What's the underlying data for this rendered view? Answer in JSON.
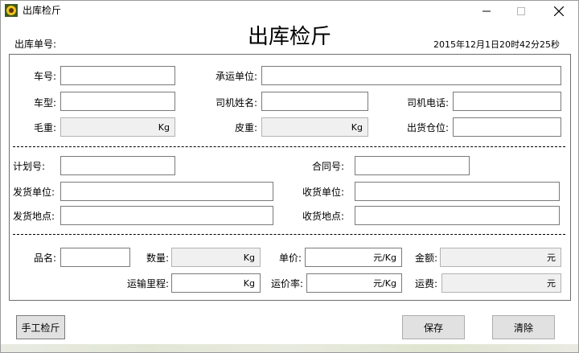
{
  "window": {
    "title": "出库检斤",
    "icon": "sunflower-icon",
    "minimize_icon": "minimize-icon",
    "maximize_icon": "maximize-icon",
    "close_icon": "close-icon"
  },
  "header": {
    "order_no_label": "出库单号:",
    "title": "出库检斤",
    "datetime": "2015年12月1日20时42分25秒"
  },
  "vehicle": {
    "car_no_label": "车号:",
    "car_no_value": "",
    "carrier_label": "承运单位:",
    "carrier_value": "",
    "car_type_label": "车型:",
    "car_type_value": "",
    "driver_name_label": "司机姓名:",
    "driver_name_value": "",
    "driver_phone_label": "司机电话:",
    "driver_phone_value": "",
    "gross_label": "毛重:",
    "gross_value": "",
    "gross_unit": "Kg",
    "tare_label": "皮重:",
    "tare_value": "",
    "tare_unit": "Kg",
    "warehouse_label": "出货仓位:",
    "warehouse_value": ""
  },
  "contract": {
    "plan_no_label": "计划号:",
    "plan_no_value": "",
    "contract_no_label": "合同号:",
    "contract_no_value": "",
    "ship_unit_label": "发货单位:",
    "ship_unit_value": "",
    "recv_unit_label": "收货单位:",
    "recv_unit_value": "",
    "ship_place_label": "发货地点:",
    "ship_place_value": "",
    "recv_place_label": "收货地点:",
    "recv_place_value": ""
  },
  "goods": {
    "name_label": "品名:",
    "name_value": "",
    "qty_label": "数量:",
    "qty_unit": "Kg",
    "price_label": "单价:",
    "price_unit": "元/Kg",
    "amount_label": "金额:",
    "amount_unit": "元",
    "distance_label": "运输里程:",
    "distance_unit": "Kg",
    "freight_rate_label": "运价率:",
    "freight_rate_unit": "元/Kg",
    "freight_label": "运费:",
    "freight_unit": "元"
  },
  "buttons": {
    "manual": "手工检斤",
    "save": "保存",
    "clear": "清除"
  }
}
